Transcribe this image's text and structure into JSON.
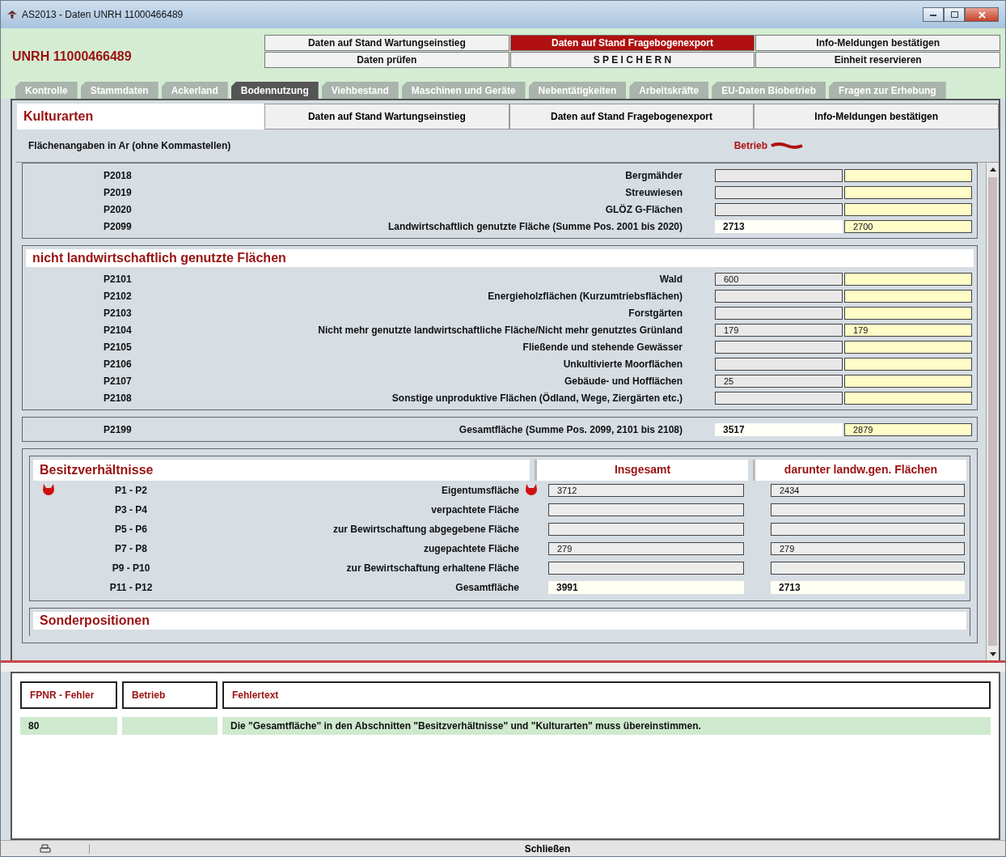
{
  "window": {
    "title": "AS2013 - Daten UNRH 11000466489"
  },
  "header": {
    "title": "UNRH 11000466489",
    "buttons": [
      {
        "label": "Daten auf Stand Wartungseinstieg",
        "selected": false
      },
      {
        "label": "Daten auf Stand Fragebogenexport",
        "selected": true
      },
      {
        "label": "Info-Meldungen bestätigen",
        "selected": false
      },
      {
        "label": "Daten prüfen",
        "selected": false
      },
      {
        "label": "S P E I C H E R N",
        "selected": false
      },
      {
        "label": "Einheit reservieren",
        "selected": false
      }
    ]
  },
  "tabs": [
    {
      "label": "Kontrolle",
      "selected": false
    },
    {
      "label": "Stammdaten",
      "selected": false
    },
    {
      "label": "Ackerland",
      "selected": false
    },
    {
      "label": "Bodennutzung",
      "selected": true
    },
    {
      "label": "Viehbestand",
      "selected": false
    },
    {
      "label": "Maschinen und Geräte",
      "selected": false
    },
    {
      "label": "Nebentätigkeiten",
      "selected": false
    },
    {
      "label": "Arbeitskräfte",
      "selected": false
    },
    {
      "label": "EU-Daten Biobetrieb",
      "selected": false
    },
    {
      "label": "Fragen zur Erhebung",
      "selected": false
    }
  ],
  "panel": {
    "title": "Kulturarten",
    "buttons": [
      "Daten auf Stand Wartungseinstieg",
      "Daten auf Stand Fragebogenexport",
      "Info-Meldungen bestätigen"
    ],
    "note": "Flächenangaben in Ar (ohne Kommastellen)",
    "betrieb": "Betrieb"
  },
  "sections": [
    {
      "rows": [
        {
          "code": "P2018",
          "label": "Bergmähder",
          "kind": "input"
        },
        {
          "code": "P2019",
          "label": "Streuwiesen",
          "kind": "input"
        },
        {
          "code": "P2020",
          "label": "GLÖZ G-Flächen",
          "kind": "input"
        },
        {
          "code": "P2099",
          "label": "Landwirtschaftlich genutzte Fläche (Summe Pos. 2001 bis 2020)",
          "kind": "total",
          "value_1": "2713",
          "value_2": "2700"
        }
      ]
    },
    {
      "title": "nicht landwirtschaftlich genutzte Flächen",
      "rows": [
        {
          "code": "P2101",
          "label": "Wald",
          "kind": "input",
          "value_1": "600"
        },
        {
          "code": "P2102",
          "label": "Energieholzflächen (Kurzumtriebsflächen)",
          "kind": "input"
        },
        {
          "code": "P2103",
          "label": "Forstgärten",
          "kind": "input"
        },
        {
          "code": "P2104",
          "label": "Nicht mehr genutzte landwirtschaftliche Fläche/Nicht mehr genutztes Grünland",
          "kind": "input",
          "value_1": "179",
          "value_2": "179"
        },
        {
          "code": "P2105",
          "label": "Fließende und stehende Gewässer",
          "kind": "input"
        },
        {
          "code": "P2106",
          "label": "Unkultivierte Moorflächen",
          "kind": "input"
        },
        {
          "code": "P2107",
          "label": "Gebäude- und Hofflächen",
          "kind": "input",
          "value_1": "25"
        },
        {
          "code": "P2108",
          "label": "Sonstige unproduktive Flächen (Ödland, Wege, Ziergärten etc.)",
          "kind": "input"
        }
      ]
    },
    {
      "rows": [
        {
          "code": "P2199",
          "label": "Gesamtfläche (Summe Pos. 2099, 2101 bis 2108)",
          "kind": "total",
          "value_1": "3517",
          "value_2": "2879"
        }
      ]
    }
  ],
  "besitz": {
    "title": "Besitzverhältnisse",
    "columns": [
      "Insgesamt",
      "darunter landw.gen. Flächen"
    ],
    "rows": [
      {
        "code": "P1 - P2",
        "label": "Eigentumsfläche",
        "flagged": true,
        "kind": "input",
        "value_1": "3712",
        "value_2": "2434"
      },
      {
        "code": "P3 - P4",
        "label": "verpachtete Fläche",
        "flagged": false,
        "kind": "input"
      },
      {
        "code": "P5 - P6",
        "label": "zur Bewirtschaftung abgegebene Fläche",
        "flagged": false,
        "kind": "input"
      },
      {
        "code": "P7 - P8",
        "label": "zugepachtete Fläche",
        "flagged": false,
        "kind": "input",
        "value_1": "279",
        "value_2": "279"
      },
      {
        "code": "P9 - P10",
        "label": "zur Bewirtschaftung erhaltene Fläche",
        "flagged": false,
        "kind": "input"
      },
      {
        "code": "P11 - P12",
        "label": "Gesamtfläche",
        "flagged": false,
        "kind": "total",
        "value_1": "3991",
        "value_2": "2713"
      }
    ]
  },
  "next_section": {
    "title": "Sonderpositionen"
  },
  "errors": {
    "columns": [
      "FPNR - Fehler",
      "Betrieb",
      "Fehlertext"
    ],
    "rows": [
      {
        "fpnr": "80",
        "text": "Die \"Gesamtfläche\" in den Abschnitten \"Besitzverhältnisse\" und \"Kulturarten\" muss übereinstimmen."
      }
    ]
  },
  "footer": {
    "close": "Schließen"
  }
}
